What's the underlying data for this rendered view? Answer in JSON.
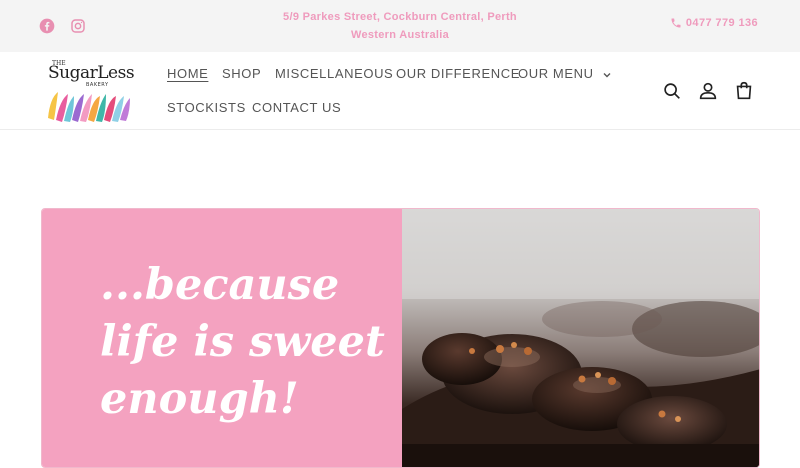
{
  "announcement": {
    "address_line1": "5/9 Parkes Street, Cockburn Central, Perth",
    "address_line2": "Western Australia",
    "phone": "0477 779 136",
    "social_icons": [
      "facebook-icon",
      "instagram-icon"
    ]
  },
  "brand": {
    "the": "THE",
    "name": "SugarLess",
    "sub": "BAKERY"
  },
  "nav": {
    "items": [
      {
        "label": "HOME",
        "active": true
      },
      {
        "label": "SHOP"
      },
      {
        "label": "MISCELLANEOUS"
      },
      {
        "label": "OUR DIFFERENCE"
      },
      {
        "label": "OUR MENU",
        "has_dropdown": true
      },
      {
        "label": "STOCKISTS"
      },
      {
        "label": "CONTACT US"
      }
    ]
  },
  "header_icons": [
    "search-icon",
    "account-icon",
    "cart-icon"
  ],
  "hero": {
    "line1": "...because",
    "line2": "life is sweet",
    "line3": "enough!"
  },
  "colors": {
    "accent_pink": "#ef9bbd",
    "hero_pink": "#f4a2c0",
    "announcement_bg": "#f4f4f4"
  }
}
